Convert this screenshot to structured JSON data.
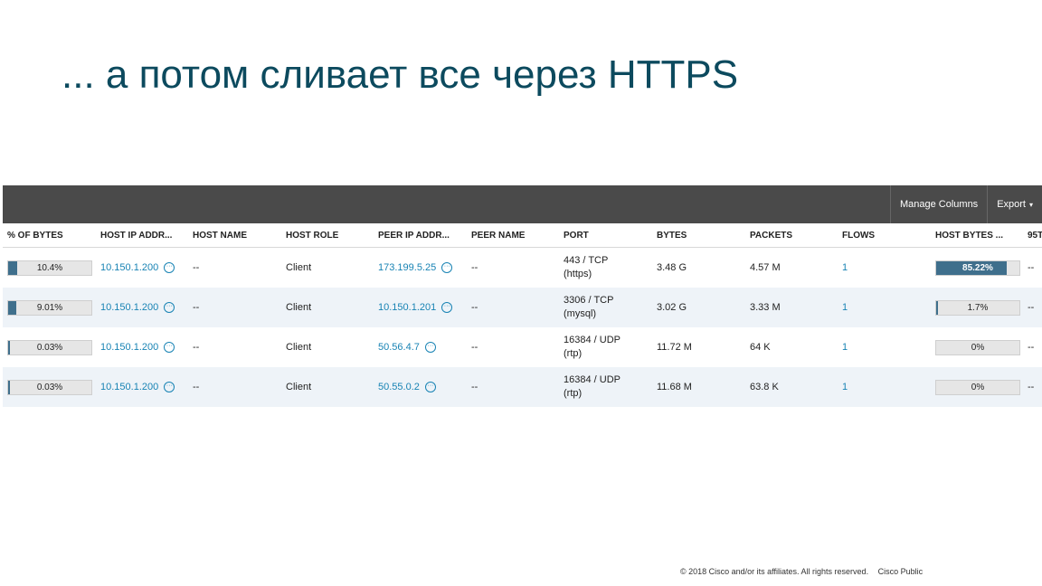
{
  "slide": {
    "title": "... а потом сливает все через HTTPS",
    "footer_copyright": "© 2018  Cisco and/or its affiliates. All rights reserved.",
    "footer_class": "Cisco Public"
  },
  "toolbar": {
    "manage_columns": "Manage Columns",
    "export": "Export",
    "export_caret": "▾"
  },
  "table": {
    "columns": [
      "% OF BYTES",
      "HOST IP ADDR...",
      "HOST NAME",
      "HOST ROLE",
      "PEER IP ADDR...",
      "PEER NAME",
      "PORT",
      "BYTES",
      "PACKETS",
      "FLOWS",
      "HOST BYTES ...",
      "95T"
    ],
    "rows": [
      {
        "pct_bytes": "10.4%",
        "pct_bytes_fill": 0.104,
        "host_ip": "10.150.1.200",
        "host_name": "--",
        "host_role": "Client",
        "peer_ip": "173.199.5.25",
        "peer_name": "--",
        "port": "443 / TCP",
        "protocol": "(https)",
        "bytes": "3.48 G",
        "packets": "4.57 M",
        "flows": "1",
        "host_bytes": "85.22%",
        "host_bytes_fill": 0.8522,
        "col95": "--"
      },
      {
        "pct_bytes": "9.01%",
        "pct_bytes_fill": 0.0901,
        "host_ip": "10.150.1.200",
        "host_name": "--",
        "host_role": "Client",
        "peer_ip": "10.150.1.201",
        "peer_name": "--",
        "port": "3306 / TCP",
        "protocol": "(mysql)",
        "bytes": "3.02 G",
        "packets": "3.33 M",
        "flows": "1",
        "host_bytes": "1.7%",
        "host_bytes_fill": 0.017,
        "col95": "--"
      },
      {
        "pct_bytes": "0.03%",
        "pct_bytes_fill": 0.0003,
        "host_ip": "10.150.1.200",
        "host_name": "--",
        "host_role": "Client",
        "peer_ip": "50.56.4.7",
        "peer_name": "--",
        "port": "16384 / UDP",
        "protocol": "(rtp)",
        "bytes": "11.72 M",
        "packets": "64 K",
        "flows": "1",
        "host_bytes": "0%",
        "host_bytes_fill": 0,
        "col95": "--"
      },
      {
        "pct_bytes": "0.03%",
        "pct_bytes_fill": 0.0003,
        "host_ip": "10.150.1.200",
        "host_name": "--",
        "host_role": "Client",
        "peer_ip": "50.55.0.2",
        "peer_name": "--",
        "port": "16384 / UDP",
        "protocol": "(rtp)",
        "bytes": "11.68 M",
        "packets": "63.8 K",
        "flows": "1",
        "host_bytes": "0%",
        "host_bytes_fill": 0,
        "col95": "--"
      }
    ]
  },
  "icons": {
    "more": "more-options-icon",
    "caret": "caret-down-icon"
  },
  "colors": {
    "title": "#0c4a5e",
    "toolbar_bg": "#4a4a4a",
    "bar_fill": "#3f6f8c",
    "link": "#1883b4",
    "row_alt": "#eef3f8"
  }
}
